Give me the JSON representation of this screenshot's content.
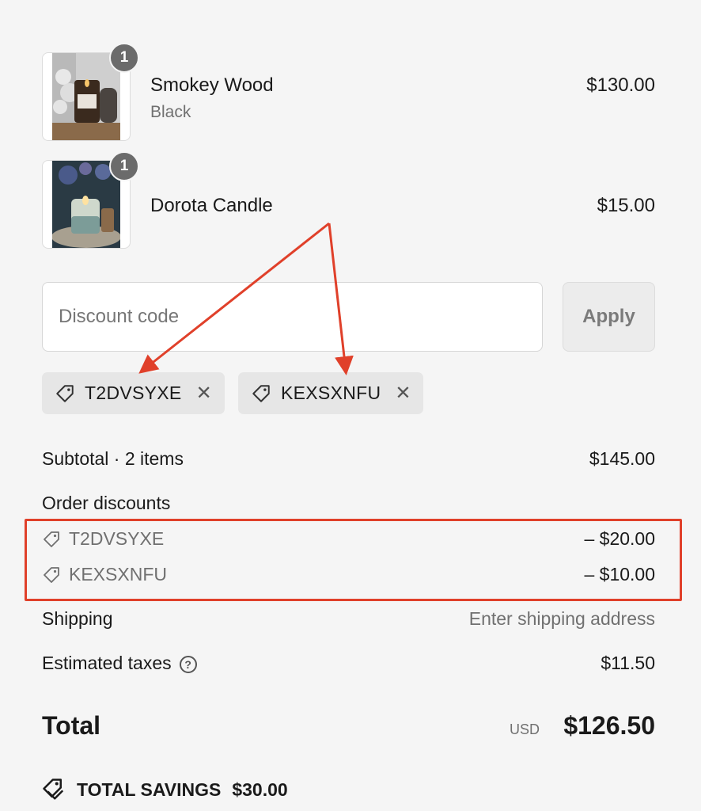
{
  "products": [
    {
      "title": "Smokey Wood",
      "variant": "Black",
      "price": "$130.00",
      "quantity": "1"
    },
    {
      "title": "Dorota Candle",
      "variant": "",
      "price": "$15.00",
      "quantity": "1"
    }
  ],
  "discount": {
    "placeholder": "Discount code",
    "apply_label": "Apply",
    "applied_codes": [
      "T2DVSYXE",
      "KEXSXNFU"
    ]
  },
  "summary": {
    "subtotal_label": "Subtotal · 2 items",
    "subtotal_value": "$145.00",
    "order_discounts_label": "Order discounts",
    "discounts": [
      {
        "code": "T2DVSYXE",
        "amount": "– $20.00"
      },
      {
        "code": "KEXSXNFU",
        "amount": "– $10.00"
      }
    ],
    "shipping_label": "Shipping",
    "shipping_value": "Enter shipping address",
    "taxes_label": "Estimated taxes",
    "taxes_help": "?",
    "taxes_value": "$11.50",
    "total_label": "Total",
    "currency": "USD",
    "total_value": "$126.50",
    "savings_label": "TOTAL SAVINGS",
    "savings_value": "$30.00"
  },
  "colors": {
    "annotation": "#e0402a",
    "background": "#f5f5f5",
    "badge": "#6b6b6b"
  },
  "icons": {
    "tag": "tag-icon",
    "remove": "close-icon",
    "help": "help-circle-icon",
    "savings": "savings-tag-icon"
  }
}
